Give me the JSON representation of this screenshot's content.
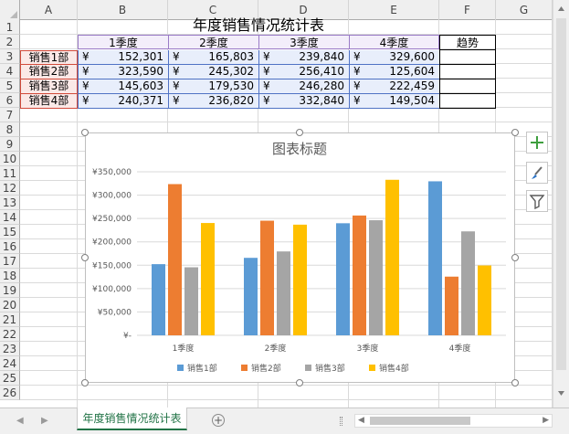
{
  "spreadsheet": {
    "columns": [
      "A",
      "B",
      "C",
      "D",
      "E",
      "F",
      "G"
    ],
    "rows": [
      "1",
      "2",
      "3",
      "4",
      "5",
      "6",
      "7",
      "8",
      "9",
      "10",
      "11",
      "12",
      "13",
      "14",
      "15",
      "16",
      "17",
      "18",
      "19",
      "20",
      "21",
      "22",
      "23",
      "24",
      "25",
      "26"
    ]
  },
  "table": {
    "title": "年度销售情况统计表",
    "headers": [
      "1季度",
      "2季度",
      "3季度",
      "4季度"
    ],
    "trend_header": "趋势",
    "currency": "¥",
    "rows": [
      {
        "label": "销售1部",
        "values": [
          "152,301",
          "165,803",
          "239,840",
          "329,600"
        ]
      },
      {
        "label": "销售2部",
        "values": [
          "323,590",
          "245,302",
          "256,410",
          "125,604"
        ]
      },
      {
        "label": "销售3部",
        "values": [
          "145,603",
          "179,530",
          "246,280",
          "222,459"
        ]
      },
      {
        "label": "销售4部",
        "values": [
          "240,371",
          "236,820",
          "332,840",
          "149,504"
        ]
      }
    ]
  },
  "sheet_tab": {
    "name": "年度销售情况统计表",
    "add_label": "+"
  },
  "chart_data": {
    "type": "bar",
    "title": "图表标题",
    "categories": [
      "1季度",
      "2季度",
      "3季度",
      "4季度"
    ],
    "series": [
      {
        "name": "销售1部",
        "color": "#5b9bd5",
        "values": [
          152301,
          165803,
          239840,
          329600
        ]
      },
      {
        "name": "销售2部",
        "color": "#ed7d31",
        "values": [
          323590,
          245302,
          256410,
          125604
        ]
      },
      {
        "name": "销售3部",
        "color": "#a5a5a5",
        "values": [
          145603,
          179530,
          246280,
          222459
        ]
      },
      {
        "name": "销售4部",
        "color": "#ffc000",
        "values": [
          240371,
          236820,
          332840,
          149504
        ]
      }
    ],
    "yticks": [
      "¥-",
      "¥50,000",
      "¥100,000",
      "¥150,000",
      "¥200,000",
      "¥250,000",
      "¥300,000",
      "¥350,000"
    ],
    "ylim": [
      0,
      350000
    ],
    "grid": true,
    "legend": "bottom"
  },
  "icons": {
    "add_elements": "plus-icon",
    "styles": "brush-icon",
    "filter": "filter-icon"
  }
}
